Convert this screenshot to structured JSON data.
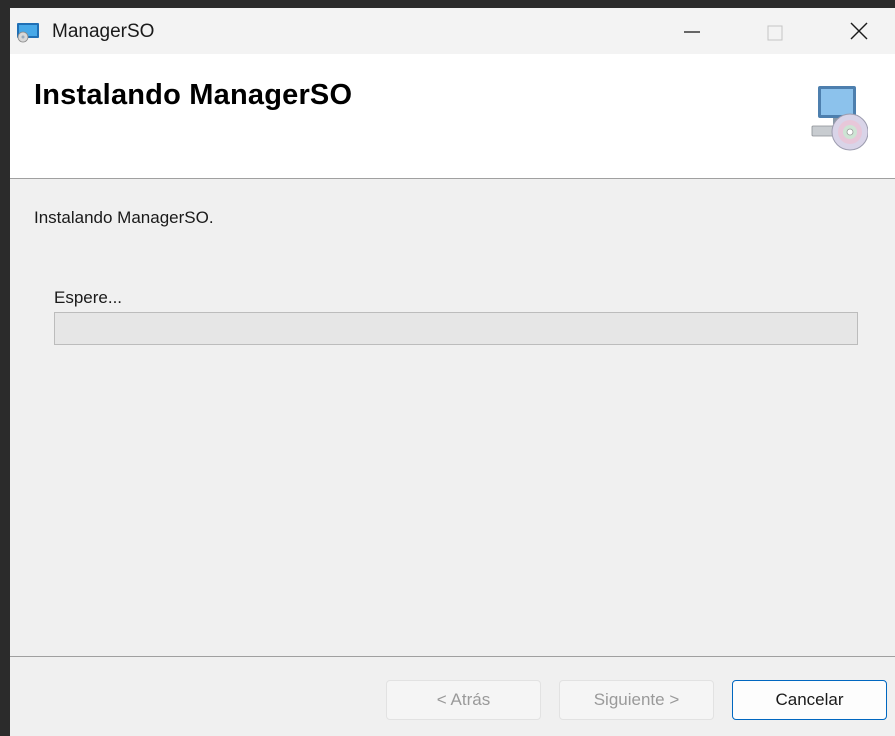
{
  "window": {
    "title": "ManagerSO",
    "app_icon": "installer-app-icon",
    "controls": {
      "minimize_icon": "minimize-icon",
      "maximize_icon": "maximize-icon",
      "close_icon": "close-icon"
    }
  },
  "header": {
    "title": "Instalando ManagerSO",
    "icon": "computer-cd-icon"
  },
  "main": {
    "status": "Instalando ManagerSO.",
    "progress_label": "Espere...",
    "progress_value": 0
  },
  "footer": {
    "back_label": "< Atrás",
    "next_label": "Siguiente >",
    "cancel_label": "Cancelar"
  },
  "colors": {
    "accent": "#0067c0",
    "header_bg": "#ffffff",
    "body_bg": "#f0f0f0"
  }
}
